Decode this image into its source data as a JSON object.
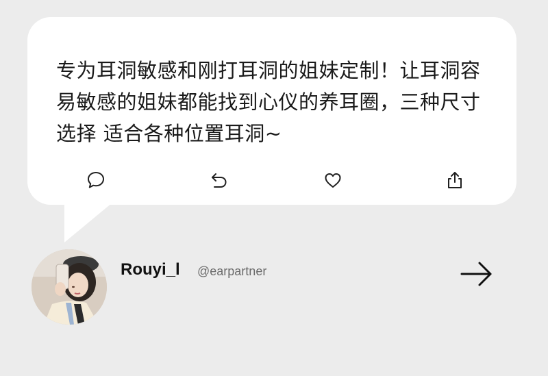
{
  "post": {
    "text": "专为耳洞敏感和刚打耳洞的姐妹定制！让耳洞容易敏感的姐妹都能找到心仪的养耳圈，三种尺寸选择 适合各种位置耳洞~"
  },
  "actions": {
    "comment_icon": "comment-icon",
    "reply_icon": "reply-icon",
    "like_icon": "heart-icon",
    "share_icon": "share-icon"
  },
  "author": {
    "name": "Rouyi_l",
    "handle": "@earpartner"
  },
  "navigation": {
    "next_icon": "arrow-right-icon"
  },
  "colors": {
    "background": "#ececec",
    "bubble": "#ffffff",
    "text": "#1a1a1a",
    "handle": "#6b6b6b"
  }
}
